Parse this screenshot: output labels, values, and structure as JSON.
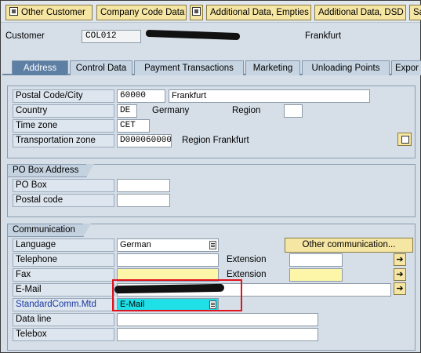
{
  "toolbar": {
    "other_customer": "Other Customer",
    "company_code_data": "Company Code Data",
    "additional_data_empties": "Additional Data, Empties",
    "additional_data_dsd": "Additional Data, DSD",
    "sales_truncated": "Sa"
  },
  "header": {
    "customer_label": "Customer",
    "customer_value": "COL012",
    "city": "Frankfurt"
  },
  "tabs": [
    {
      "label": "Address",
      "active": true
    },
    {
      "label": "Control Data"
    },
    {
      "label": "Payment Transactions"
    },
    {
      "label": "Marketing"
    },
    {
      "label": "Unloading Points"
    },
    {
      "label": "Expor"
    }
  ],
  "address": {
    "postal_city_label": "Postal Code/City",
    "postal_code": "60000",
    "city": "Frankfurt",
    "country_label": "Country",
    "country_code": "DE",
    "country_name": "Germany",
    "region_label": "Region",
    "region_value": "",
    "timezone_label": "Time zone",
    "timezone_value": "CET",
    "transport_zone_label": "Transportation zone",
    "transport_zone_value": "D000060000",
    "transport_zone_desc": "Region Frankfurt"
  },
  "po_box": {
    "title": "PO Box Address",
    "po_box_label": "PO Box",
    "postal_code_label": "Postal code"
  },
  "communication": {
    "title": "Communication",
    "language_label": "Language",
    "language_value": "German",
    "other_comm_button": "Other communication...",
    "telephone_label": "Telephone",
    "extension_label": "Extension",
    "fax_label": "Fax",
    "fax_extension_label": "Extension",
    "email_label": "E-Mail",
    "std_comm_label": "StandardComm.Mtd",
    "std_comm_value": "E-Mail",
    "data_line_label": "Data line",
    "telebox_label": "Telebox"
  },
  "colors": {
    "highlight_box": "#e0141e",
    "required_field": "#fdf6a8",
    "selected_field": "#1ee0e6",
    "active_tab": "#5d7fa4"
  }
}
